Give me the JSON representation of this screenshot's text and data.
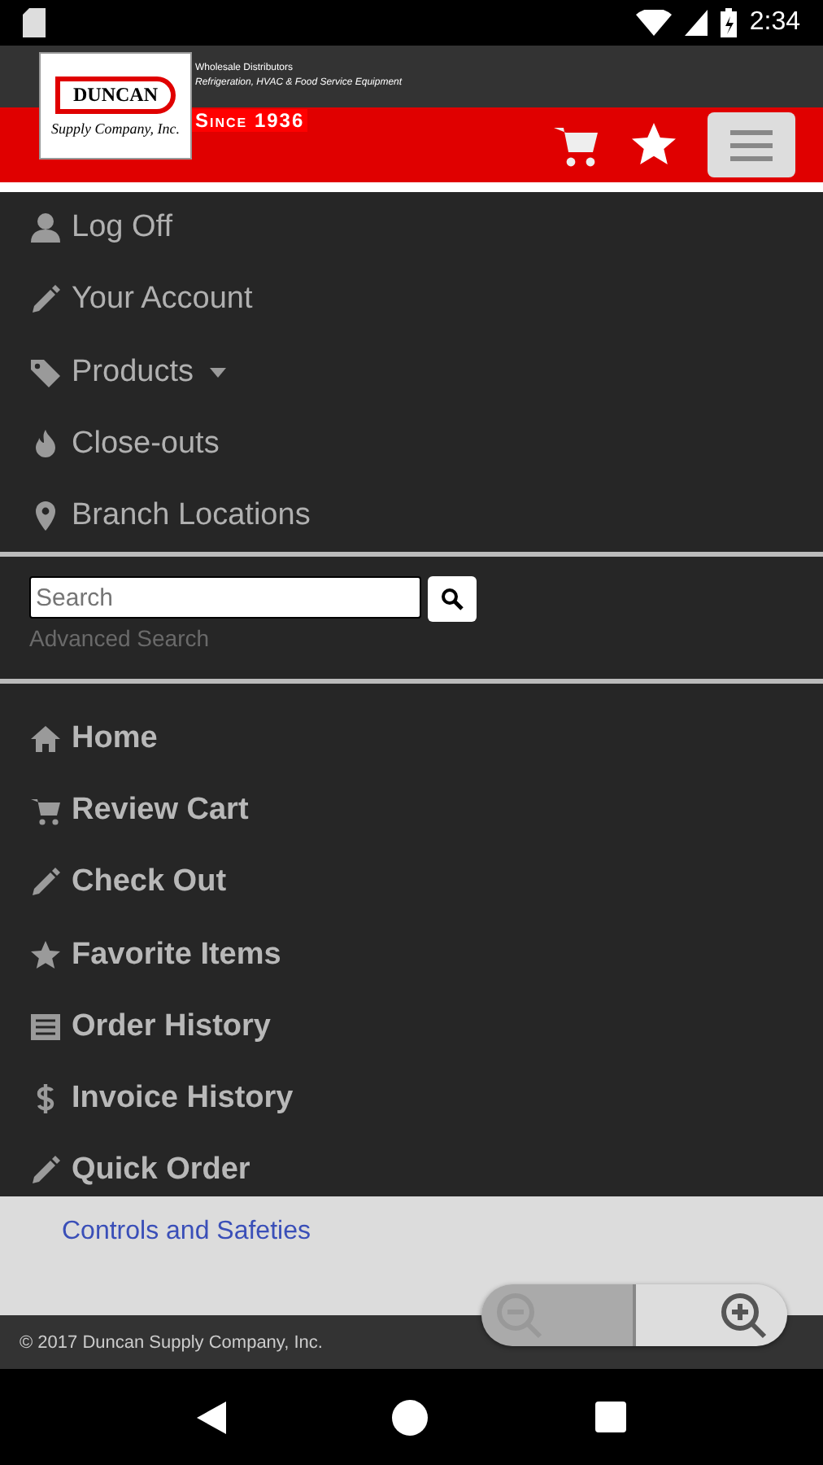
{
  "status_bar": {
    "time": "2:34"
  },
  "header": {
    "logo_name": "DUNCAN",
    "logo_sub": "Supply Company, Inc.",
    "tagline": "Wholesale Distributors",
    "tagline_sub": "Refrigeration, HVAC & Food Service Equipment",
    "since": "Since 1936"
  },
  "account_menu": [
    {
      "label": "Log Off",
      "kind": "link"
    },
    {
      "label": "Your Account",
      "kind": "link"
    },
    {
      "label": "Products",
      "kind": "dropdown"
    },
    {
      "label": "Close-outs",
      "kind": "link"
    },
    {
      "label": "Branch Locations",
      "kind": "link"
    }
  ],
  "search": {
    "placeholder": "Search",
    "advanced_link": "Advanced Search"
  },
  "main_menu": [
    {
      "label": "Home"
    },
    {
      "label": "Review Cart"
    },
    {
      "label": "Check Out"
    },
    {
      "label": "Favorite Items"
    },
    {
      "label": "Order History"
    },
    {
      "label": "Invoice History"
    },
    {
      "label": "Quick Order"
    }
  ],
  "dropdown": [
    "Controls and Safeties"
  ],
  "footer": {
    "copyright": "© 2017 Duncan Supply Company, Inc."
  }
}
